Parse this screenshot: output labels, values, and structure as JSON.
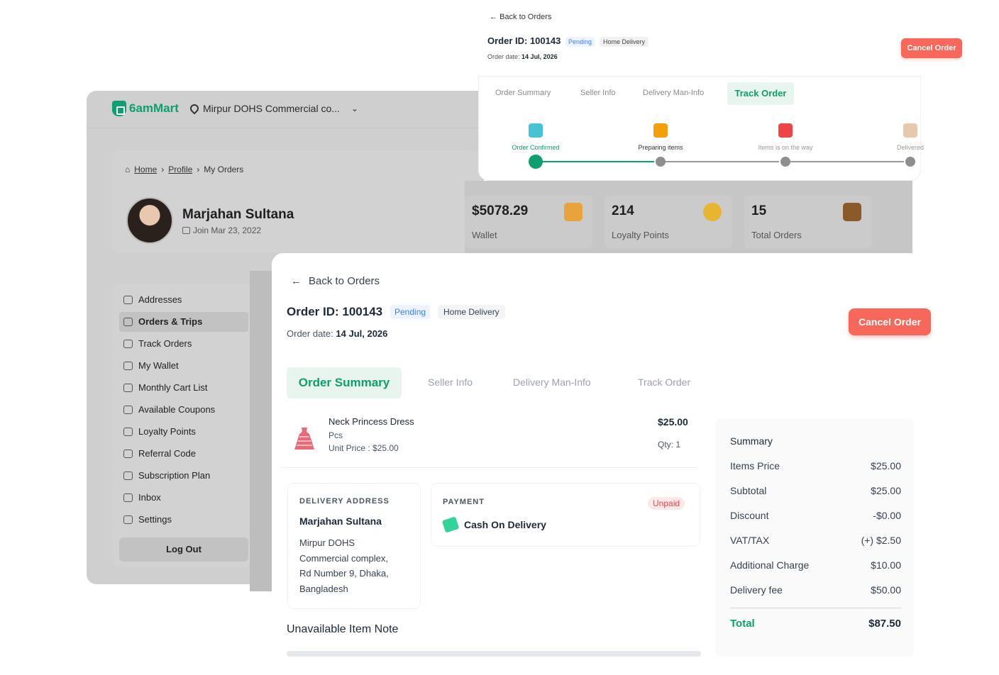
{
  "bg": {
    "brand": "6amMart",
    "location": "Mirpur DOHS Commercial co...",
    "breadcrumb": {
      "home": "Home",
      "profile": "Profile",
      "current": "My Orders"
    },
    "profile": {
      "name": "Marjahan Sultana",
      "join": "Join Mar 23, 2022"
    },
    "stats": [
      {
        "value": "$5078.29",
        "label": "Wallet"
      },
      {
        "value": "214",
        "label": "Loyalty Points"
      },
      {
        "value": "15",
        "label": "Total Orders"
      }
    ],
    "menu": [
      "Addresses",
      "Orders & Trips",
      "Track Orders",
      "My Wallet",
      "Monthly Cart List",
      "Available Coupons",
      "Loyalty Points",
      "Referral Code",
      "Subscription Plan",
      "Inbox",
      "Settings"
    ],
    "logout": "Log Out"
  },
  "mini": {
    "back": "Back to Orders",
    "order_id": "Order ID: 100143",
    "status": "Pending",
    "type": "Home Delivery",
    "date_label": "Order date:",
    "date": "14 Jul, 2026",
    "cancel": "Cancel Order",
    "tabs": [
      "Order Summary",
      "Seller Info",
      "Delivery Man-Info",
      "Track Order"
    ],
    "steps": [
      "Order Confirmed",
      "Preparing items",
      "Items is on the way",
      "Delivered"
    ]
  },
  "order": {
    "back": "Back to Orders",
    "order_id": "Order ID: 100143",
    "status": "Pending",
    "type": "Home Delivery",
    "date_label": "Order date:",
    "date": "14 Jul, 2026",
    "cancel": "Cancel Order",
    "tabs": [
      "Order Summary",
      "Seller Info",
      "Delivery Man-Info",
      "Track Order"
    ],
    "item": {
      "name": "Neck Princess Dress",
      "unit": "Pcs",
      "unit_price": "Unit Price : $25.00",
      "price": "$25.00",
      "qty": "Qty: 1"
    },
    "address": {
      "heading": "DELIVERY ADDRESS",
      "name": "Marjahan Sultana",
      "lines": [
        "Mirpur DOHS",
        "Commercial complex,",
        "Rd Number 9, Dhaka,",
        "Bangladesh"
      ]
    },
    "payment": {
      "heading": "PAYMENT",
      "status": "Unpaid",
      "method": "Cash On Delivery"
    },
    "unavailable_note": "Unavailable Item Note",
    "summary": {
      "heading": "Summary",
      "rows": [
        {
          "label": "Items Price",
          "value": "$25.00"
        },
        {
          "label": "Subtotal",
          "value": "$25.00"
        },
        {
          "label": "Discount",
          "value": "-$0.00"
        },
        {
          "label": "VAT/TAX",
          "value": "(+) $2.50"
        },
        {
          "label": "Additional Charge",
          "value": "$10.00"
        },
        {
          "label": "Delivery fee",
          "value": "$50.00"
        }
      ],
      "total_label": "Total",
      "total_value": "$87.50"
    }
  },
  "colors": {
    "brand": "#0e9f6e",
    "danger": "#f8685a",
    "pending": "#3b82f6"
  }
}
